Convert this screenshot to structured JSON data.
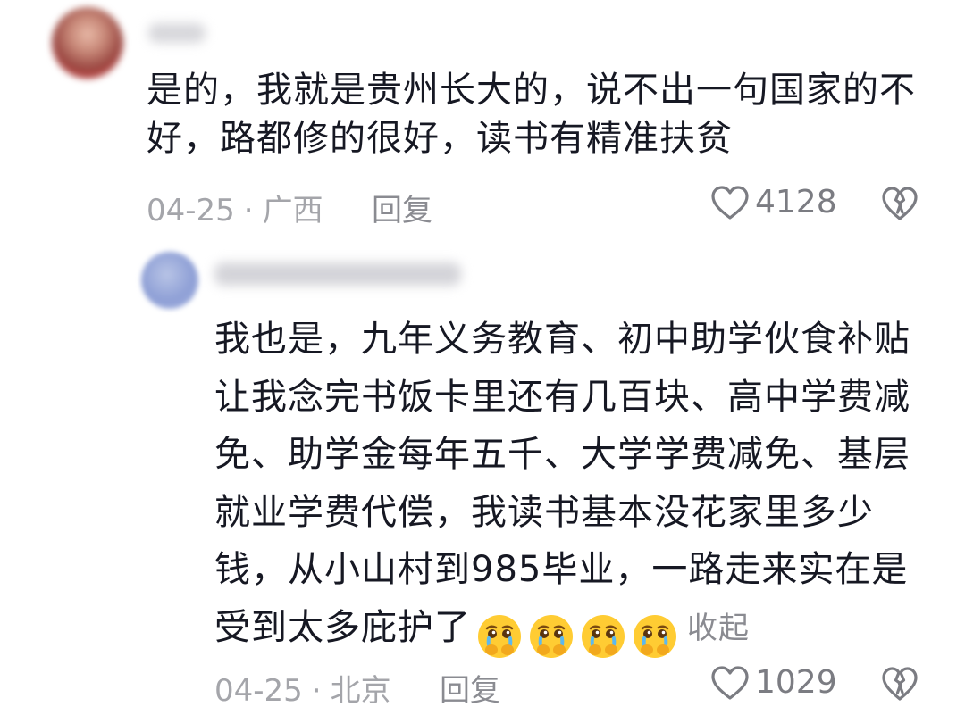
{
  "comments": [
    {
      "text": "是的，我就是贵州长大的，说不出一句国家的不好，路都修的很好，读书有精准扶贫",
      "date": "04-25",
      "dot": "·",
      "location": "广西",
      "reply_label": "回复",
      "likes": "4128"
    },
    {
      "text": "我也是，九年义务教育、初中助学伙食补贴让我念完书饭卡里还有几百块、高中学费减免、助学金每年五千、大学学费减免、基层就业学费代偿，我读书基本没花家里多少钱，从小山村到985毕业，一路走来实在是受到太多庇护了",
      "collapse_label": "收起",
      "date": "04-25",
      "dot": "·",
      "location": "北京",
      "reply_label": "回复",
      "likes": "1029"
    }
  ],
  "icons": {
    "like": "heart-outline-icon",
    "dislike": "broken-heart-icon",
    "emoji": "crying-face-emoji"
  },
  "colors": {
    "text": "#161823",
    "meta": "#a4a5aa",
    "icon": "#7b7c82"
  }
}
